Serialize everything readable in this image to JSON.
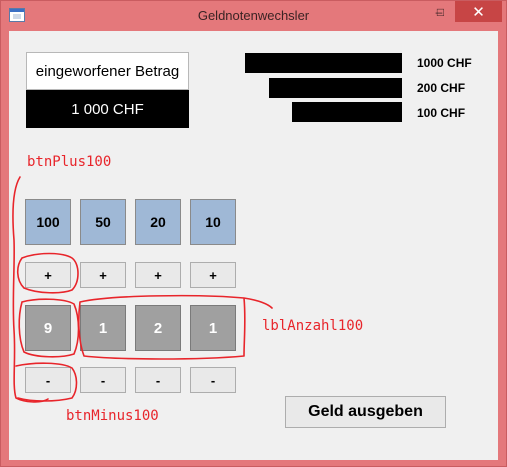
{
  "window": {
    "title": "Geldnotenwechsler",
    "minimize_glyph": "–",
    "maximize_glyph": "□",
    "close_glyph": "✕",
    "icon": "app-window-icon"
  },
  "display": {
    "label": "eingeworfener Betrag",
    "amount": "1 000 CHF"
  },
  "bars": [
    {
      "label": "1000 CHF"
    },
    {
      "label": "200 CHF"
    },
    {
      "label": "100 CHF"
    }
  ],
  "denominations": [
    "100",
    "50",
    "20",
    "10"
  ],
  "plus_label": "+",
  "minus_label": "-",
  "counts": [
    "9",
    "1",
    "2",
    "1"
  ],
  "action_button": "Geld ausgeben",
  "annotations": {
    "plus": "btnPlus100",
    "count": "lblAnzahl100",
    "minus": "btnMinus100"
  },
  "colors": {
    "titlebar": "#e4787b",
    "close": "#c74545",
    "denomination": "#9fb8d6",
    "count": "#a0a0a0",
    "annotation": "#e8252b"
  }
}
